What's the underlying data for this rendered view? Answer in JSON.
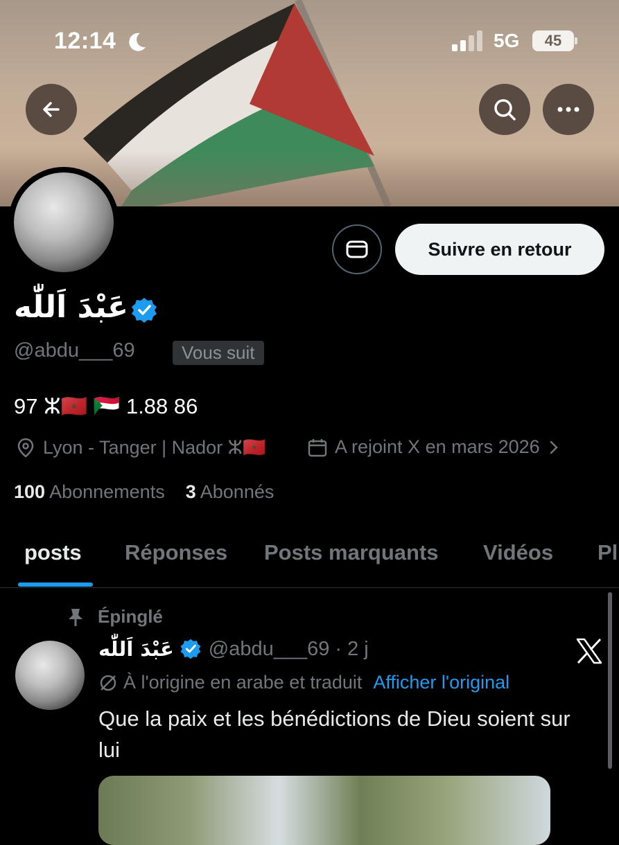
{
  "status_bar": {
    "time": "12:14",
    "network": "5G",
    "battery": "45"
  },
  "profile": {
    "display_name": "عَبْدَ اَللّٰه",
    "handle": "@abdu___69",
    "follows_you": "Vous suit",
    "follow_button": "Suivre en retour",
    "bio": "97 ⵣ🇲🇦 🇸🇩 1.88 86",
    "location": "Lyon - Tanger | Nador ⵣ🇲🇦",
    "joined": "A rejoint X en mars 2026",
    "following_count": "100",
    "following_label": "Abonnements",
    "followers_count": "3",
    "followers_label": "Abonnés"
  },
  "tabs": [
    "posts",
    "Réponses",
    "Posts marquants",
    "Vidéos",
    "Pl"
  ],
  "post": {
    "pinned_label": "Épinglé",
    "author_name": "عَبْدَ اَللّٰه",
    "author_handle": "@abdu___69 · 2 j",
    "translation_note": "À l'origine en arabe et traduit",
    "translation_link": "Afficher l'original",
    "text": "Que la paix et les bénédictions de Dieu soient sur lui"
  },
  "colors": {
    "accent": "#1d9bf0",
    "background": "#000000",
    "muted": "#71767b"
  }
}
